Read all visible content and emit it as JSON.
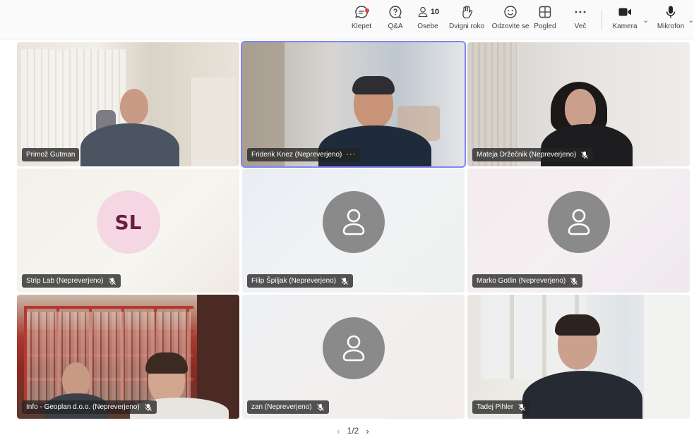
{
  "toolbar": {
    "chat": {
      "label": "Klepet",
      "icon": "chat-icon",
      "has_notification": true
    },
    "qa": {
      "label": "Q&A",
      "icon": "qa-icon"
    },
    "people": {
      "label": "Osebe",
      "icon": "people-icon",
      "count": "10"
    },
    "raise_hand": {
      "label": "Dvigni roko",
      "icon": "hand-icon"
    },
    "react": {
      "label": "Odzovite se",
      "icon": "emoji-icon"
    },
    "view": {
      "label": "Pogled",
      "icon": "grid-view-icon"
    },
    "more": {
      "label": "Več",
      "icon": "more-icon"
    },
    "camera": {
      "label": "Kamera",
      "icon": "camera-icon"
    },
    "mic": {
      "label": "Mikrofon",
      "icon": "microphone-icon"
    }
  },
  "participants": [
    {
      "name": "Primož Gutman",
      "type": "video",
      "muted": false,
      "active": false
    },
    {
      "name": "Friderik Knez (Nepreverjeno)",
      "type": "video",
      "muted": false,
      "active": true,
      "more": "···"
    },
    {
      "name": "Mateja Držečnik (Nepreverjeno)",
      "type": "video",
      "muted": true,
      "active": false
    },
    {
      "name": "Strip Lab (Nepreverjeno)",
      "type": "initials",
      "initials": "SL",
      "muted": true,
      "active": false
    },
    {
      "name": "Filip Špiljak (Nepreverjeno)",
      "type": "avatar",
      "muted": true,
      "active": false
    },
    {
      "name": "Marko Gotlin (Nepreverjeno)",
      "type": "avatar",
      "muted": true,
      "active": false
    },
    {
      "name": "Info - Geoplan d.o.o. (Nepreverjeno)",
      "type": "video",
      "muted": true,
      "active": false
    },
    {
      "name": "zan (Nepreverjeno)",
      "type": "avatar",
      "muted": true,
      "active": false
    },
    {
      "name": "Tadej Pihler",
      "type": "video",
      "muted": true,
      "active": false
    }
  ],
  "pager": {
    "text": "1/2",
    "prev": "‹",
    "next": "›"
  },
  "colors": {
    "active_outline": "#7f85f5",
    "avatar_gray": "#8a8a8a",
    "initials_bg": "#f4d7e2",
    "initials_fg": "#6b1d3e",
    "notification": "#e0413a"
  }
}
